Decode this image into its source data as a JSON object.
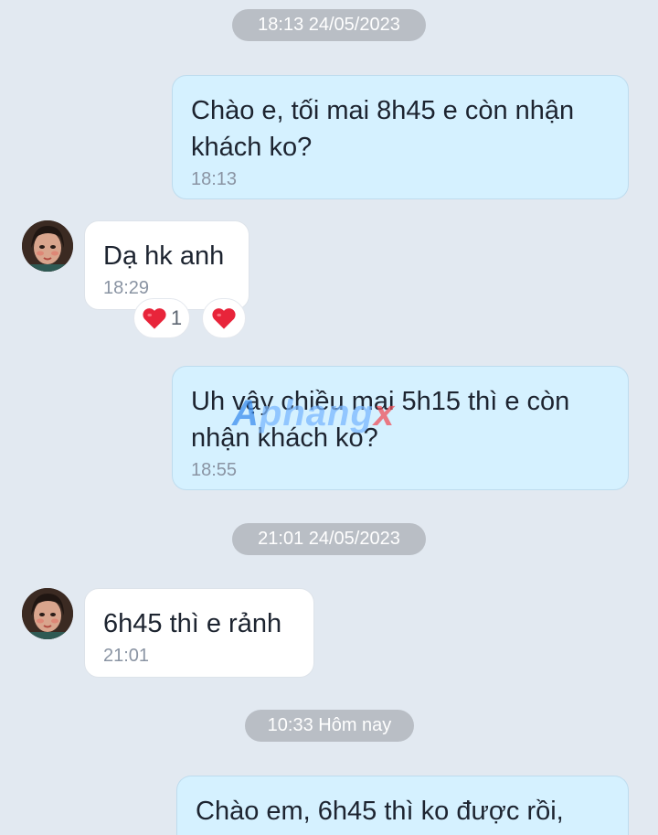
{
  "conversation": {
    "timestamps": [
      "18:13 24/05/2023",
      "21:01 24/05/2023",
      "10:33 Hôm nay"
    ],
    "messages": [
      {
        "direction": "outgoing",
        "text": "Chào e, tối mai 8h45 e còn nhận khách ko?",
        "time": "18:13"
      },
      {
        "direction": "incoming",
        "text": "Dạ hk anh",
        "time": "18:29"
      },
      {
        "direction": "outgoing",
        "text": "Uh vậy chiều mai 5h15 thì e còn nhận khách ko?",
        "time": "18:55"
      },
      {
        "direction": "incoming",
        "text": "6h45 thì e rảnh",
        "time": "21:01"
      },
      {
        "direction": "outgoing",
        "text": "Chào em, 6h45 thì ko được rồi,",
        "time": ""
      }
    ],
    "reactions": [
      {
        "icon": "heart-icon",
        "count": "1"
      },
      {
        "icon": "heart-icon",
        "count": ""
      }
    ]
  },
  "watermark": {
    "part1": "A",
    "part2": "phang",
    "part3": "x"
  },
  "colors": {
    "background": "#e2e9f1",
    "outgoing_bubble": "#d5f1ff",
    "incoming_bubble": "#ffffff",
    "timestamp_pill": "#b9bec5",
    "heart": "#e8243a"
  }
}
